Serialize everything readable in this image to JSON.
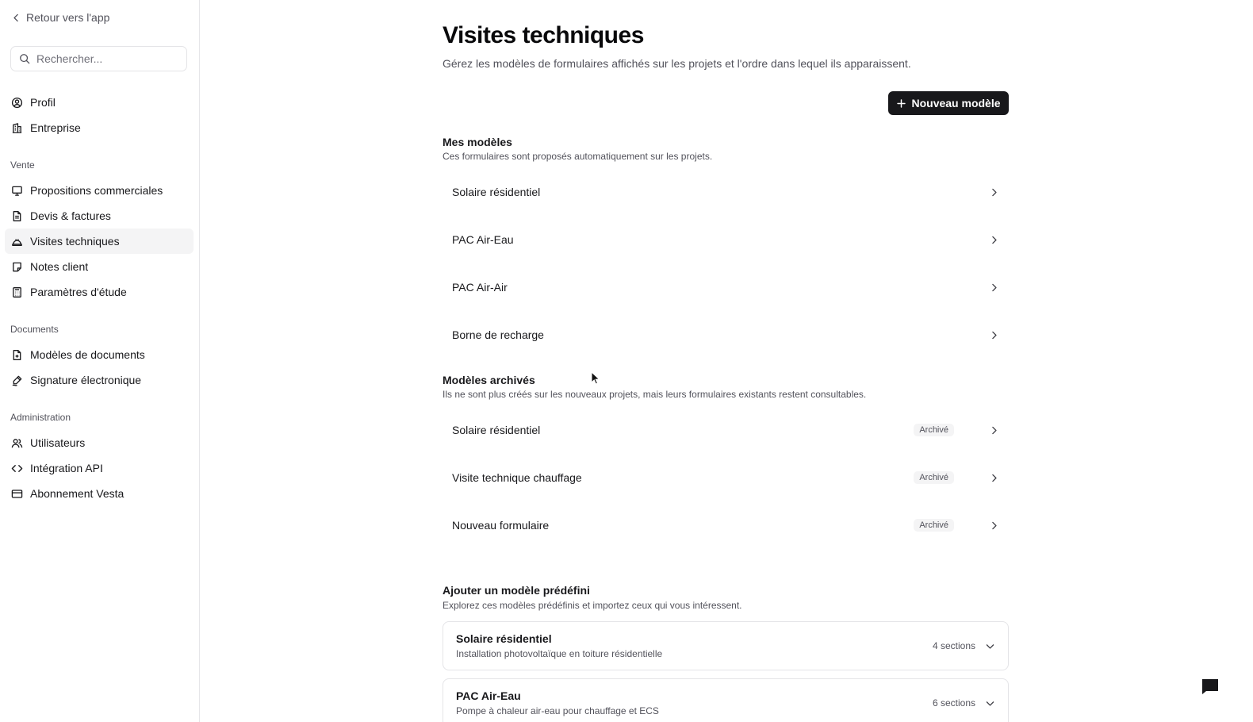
{
  "sidebar": {
    "back_label": "Retour vers l'app",
    "search_placeholder": "Rechercher...",
    "top_items": [
      {
        "label": "Profil",
        "icon": "user-circle-icon"
      },
      {
        "label": "Entreprise",
        "icon": "building-icon"
      }
    ],
    "sections": [
      {
        "heading": "Vente",
        "items": [
          {
            "label": "Propositions commerciales",
            "icon": "presentation-icon"
          },
          {
            "label": "Devis & factures",
            "icon": "file-text-icon"
          },
          {
            "label": "Visites techniques",
            "icon": "helmet-icon",
            "active": true
          },
          {
            "label": "Notes client",
            "icon": "note-icon"
          },
          {
            "label": "Paramètres d'étude",
            "icon": "calculator-icon"
          }
        ]
      },
      {
        "heading": "Documents",
        "items": [
          {
            "label": "Modèles de documents",
            "icon": "file-plus-icon"
          },
          {
            "label": "Signature électronique",
            "icon": "signature-icon"
          }
        ]
      },
      {
        "heading": "Administration",
        "items": [
          {
            "label": "Utilisateurs",
            "icon": "users-icon"
          },
          {
            "label": "Intégration API",
            "icon": "code-icon"
          },
          {
            "label": "Abonnement Vesta",
            "icon": "credit-card-icon"
          }
        ]
      }
    ]
  },
  "main": {
    "title": "Visites techniques",
    "subtitle": "Gérez les modèles de formulaires affichés sur les projets et l'ordre dans lequel ils apparaissent.",
    "new_button_label": "Nouveau modèle",
    "my_models": {
      "title": "Mes modèles",
      "subtitle": "Ces formulaires sont proposés automatiquement sur les projets.",
      "items": [
        "Solaire résidentiel",
        "PAC Air-Eau",
        "PAC Air-Air",
        "Borne de recharge"
      ]
    },
    "archived": {
      "title": "Modèles archivés",
      "subtitle": "Ils ne sont plus créés sur les nouveaux projets, mais leurs formulaires existants restent consultables.",
      "badge": "Archivé",
      "items": [
        "Solaire résidentiel",
        "Visite technique chauffage",
        "Nouveau formulaire"
      ]
    },
    "predefined": {
      "title": "Ajouter un modèle prédéfini",
      "subtitle": "Explorez ces modèles prédéfinis et importez ceux qui vous intéressent.",
      "items": [
        {
          "title": "Solaire résidentiel",
          "desc": "Installation photovoltaïque en toiture résidentielle",
          "count": "4 sections"
        },
        {
          "title": "PAC Air-Eau",
          "desc": "Pompe à chaleur air-eau pour chauffage et ECS",
          "count": "6 sections"
        }
      ]
    }
  }
}
